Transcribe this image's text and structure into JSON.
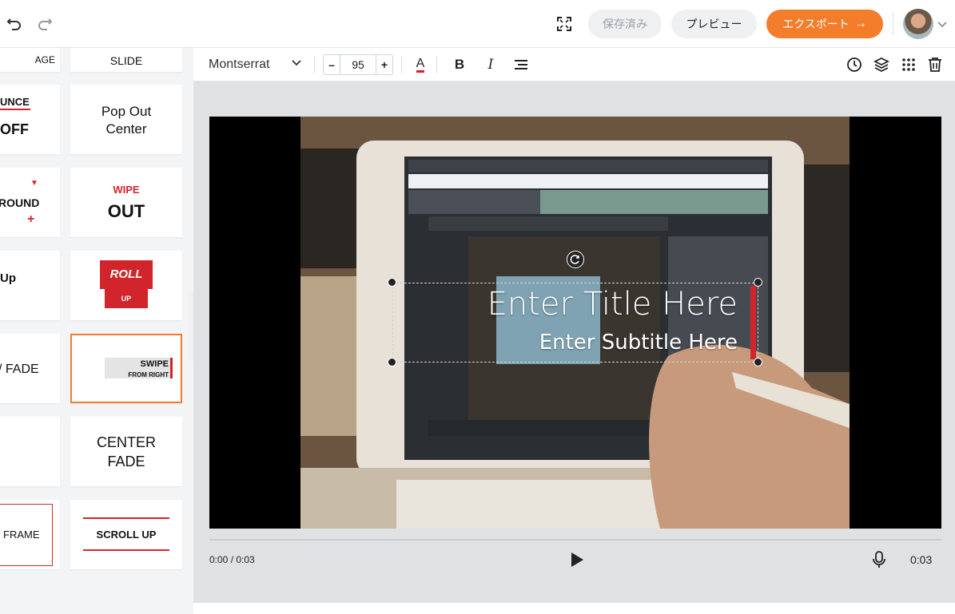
{
  "topbar": {
    "saved_label": "保存済み",
    "preview_label": "プレビュー",
    "export_label": "エクスポート",
    "export_arrow": "→"
  },
  "sidebar": {
    "left_cards": [
      {
        "label": "AGE"
      },
      {
        "label_top": "UNCE",
        "label_bottom": "OFF"
      },
      {
        "label": "ROUND",
        "mark": "+"
      },
      {
        "label": "Up"
      },
      {
        "label": "/ FADE"
      },
      {
        "label": ""
      },
      {
        "label": "FRAME"
      }
    ],
    "right_cards": [
      {
        "label": "SLIDE"
      },
      {
        "line1": "Pop Out",
        "line2": "Center"
      },
      {
        "line1": "WIPE",
        "line2": "OUT"
      },
      {
        "line1": "ROLL",
        "line2": "UP"
      },
      {
        "line1": "SWIPE",
        "line2": "FROM RIGHT"
      },
      {
        "line1": "CENTER",
        "line2": "FADE"
      },
      {
        "label": "SCROLL UP"
      }
    ]
  },
  "toolbar": {
    "font_name": "Montserrat",
    "size_minus": "–",
    "font_size": "95",
    "size_plus": "+",
    "text_color_glyph": "A",
    "bold_glyph": "B",
    "italic_glyph": "I"
  },
  "canvas": {
    "title": "Enter Title Here",
    "subtitle": "Enter Subtitle Here",
    "accent_color": "#d2252b"
  },
  "playback": {
    "time": "0:00 / 0:03",
    "duration": "0:03"
  },
  "colors": {
    "brand": "#f47d2c",
    "accent_red": "#d2252b"
  }
}
